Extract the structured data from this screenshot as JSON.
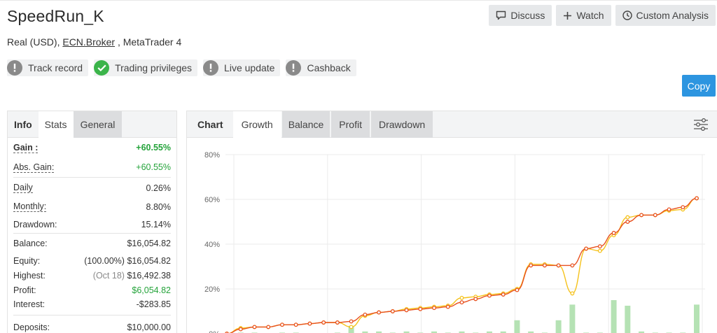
{
  "account": {
    "name": "SpeedRun_K",
    "subtitle_prefix": "Real (USD),",
    "broker": "ECN.Broker",
    "subtitle_suffix": ", MetaTrader 4"
  },
  "actions": {
    "discuss": "Discuss",
    "watch": "Watch",
    "custom_analysis": "Custom Analysis",
    "copy": "Copy"
  },
  "badges": [
    {
      "label": "Track record",
      "status": "grey"
    },
    {
      "label": "Trading privileges",
      "status": "green"
    },
    {
      "label": "Live update",
      "status": "grey"
    },
    {
      "label": "Cashback",
      "status": "grey"
    }
  ],
  "left_tabs": [
    "Info",
    "Stats",
    "General"
  ],
  "stats": {
    "gain": {
      "label": "Gain :",
      "value": "+60.55%"
    },
    "abs_gain": {
      "label": "Abs. Gain:",
      "value": "+60.55%"
    },
    "daily": {
      "label": "Daily",
      "value": "0.26%"
    },
    "monthly": {
      "label": "Monthly:",
      "value": "8.80%"
    },
    "drawdown": {
      "label": "Drawdown:",
      "value": "15.14%"
    },
    "balance": {
      "label": "Balance:",
      "value": "$16,054.82"
    },
    "equity": {
      "label": "Equity:",
      "pct": "(100.00%)",
      "value": "$16,054.82"
    },
    "highest": {
      "label": "Highest:",
      "date": "(Oct 18)",
      "value": "$16,492.38"
    },
    "profit": {
      "label": "Profit:",
      "value": "$6,054.82"
    },
    "interest": {
      "label": "Interest:",
      "value": "-$283.85"
    },
    "deposits": {
      "label": "Deposits:",
      "value": "$10,000.00"
    }
  },
  "chart_tabs": [
    "Chart",
    "Growth",
    "Balance",
    "Profit",
    "Drawdown"
  ],
  "colors": {
    "equity_line": "#f5c21b",
    "growth_line": "#e8501e",
    "bars": "#b5e2b4",
    "copy_button": "#2d95e0",
    "positive": "#24a33a"
  },
  "chart_data": {
    "type": "line",
    "ylim": [
      0,
      80
    ],
    "y_ticks": [
      "80%",
      "60%",
      "40%",
      "20%",
      "0%"
    ],
    "y_tick_values": [
      80,
      60,
      40,
      20,
      0
    ],
    "grid": true,
    "series": [
      {
        "values": [
          0,
          2.5,
          3,
          3,
          4,
          4,
          4.5,
          5,
          5,
          3,
          8,
          9.5,
          10,
          11,
          11.5,
          12,
          12.5,
          16,
          16.5,
          17.5,
          18,
          20,
          31,
          31,
          30.5,
          18,
          38,
          37,
          44,
          52,
          53,
          53,
          55,
          55.5,
          60.5
        ]
      },
      {
        "values": [
          0,
          2,
          3,
          3,
          4,
          4,
          4.5,
          5,
          5,
          5.5,
          8.5,
          9.5,
          10,
          10.5,
          11,
          11.5,
          12,
          14,
          15.5,
          17,
          17.5,
          19.5,
          30.5,
          30.5,
          30.5,
          30.5,
          38,
          39,
          45,
          50,
          53,
          53,
          55.5,
          56.5,
          60.5
        ]
      }
    ],
    "bars": [
      0,
      0.5,
      0.5,
      0,
      0.5,
      0.5,
      0.3,
      0.3,
      0.5,
      3.5,
      1,
      1,
      0.5,
      1,
      0.5,
      1,
      0.5,
      1,
      0.5,
      1,
      1,
      6,
      1,
      0.5,
      6,
      13,
      0.5,
      0.5,
      15,
      12.5,
      1,
      0.5,
      0.5,
      0.5,
      13
    ]
  }
}
